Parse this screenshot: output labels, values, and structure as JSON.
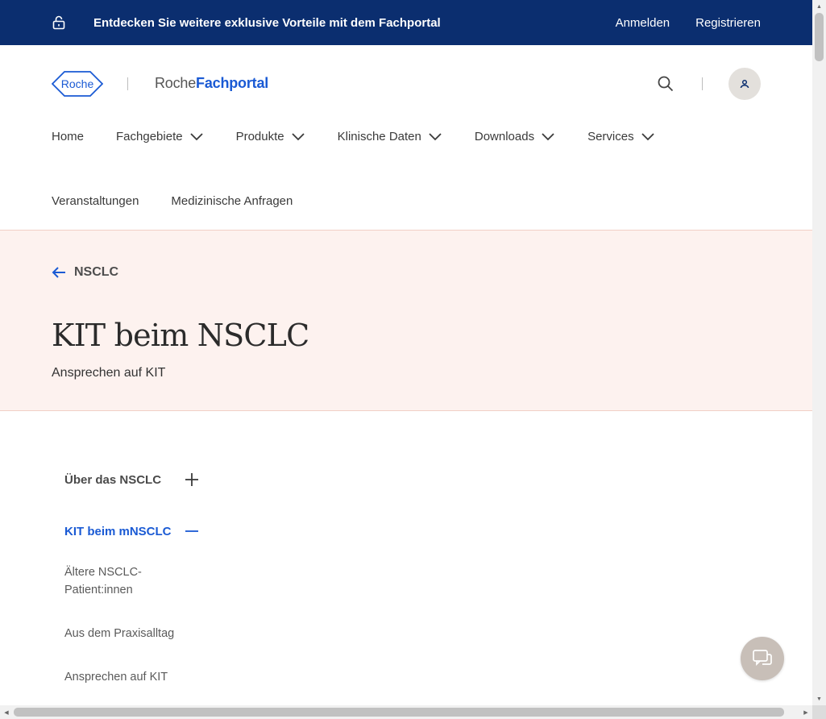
{
  "promo": {
    "text": "Entdecken Sie weitere exklusive Vorteile mit dem Fachportal",
    "login": "Anmelden",
    "register": "Registrieren",
    "icon": "lock-icon"
  },
  "header": {
    "logo_text": "Roche",
    "portal_prefix": "Roche",
    "portal_bold": "Fachportal"
  },
  "nav": {
    "row1": [
      {
        "label": "Home",
        "has_dropdown": false
      },
      {
        "label": "Fachgebiete",
        "has_dropdown": true
      },
      {
        "label": "Produkte",
        "has_dropdown": true
      },
      {
        "label": "Klinische Daten",
        "has_dropdown": true
      },
      {
        "label": "Downloads",
        "has_dropdown": true
      },
      {
        "label": "Services",
        "has_dropdown": true
      }
    ],
    "row2": [
      {
        "label": "Veranstaltungen"
      },
      {
        "label": "Medizinische Anfragen"
      }
    ]
  },
  "hero": {
    "back_label": "NSCLC",
    "title": "KIT beim NSCLC",
    "subtitle": "Ansprechen auf KIT"
  },
  "sidemenu": {
    "section1": "Über das NSCLC",
    "section2": "KIT beim mNSCLC",
    "items": [
      "Ältere NSCLC-Patient:innen",
      "Aus dem Praxisalltag",
      "Ansprechen auf KIT"
    ]
  },
  "colors": {
    "promo_bg": "#0b2e6f",
    "accent": "#1a5ad4",
    "hero_bg": "#fdf2ef"
  }
}
